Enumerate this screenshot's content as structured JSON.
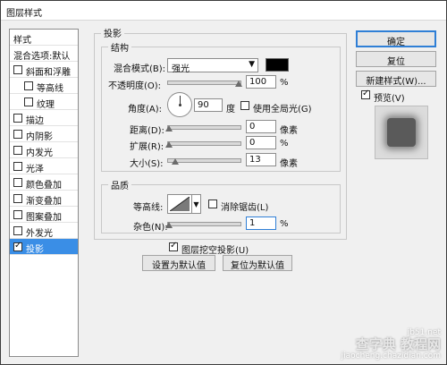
{
  "window": {
    "title": "图层样式"
  },
  "sidebar": {
    "header_styles": "样式",
    "header_blend": "混合选项:默认",
    "items": [
      {
        "label": "斜面和浮雕",
        "checked": false
      },
      {
        "label": "等高线",
        "checked": false
      },
      {
        "label": "纹理",
        "checked": false
      },
      {
        "label": "描边",
        "checked": false
      },
      {
        "label": "内阴影",
        "checked": false
      },
      {
        "label": "内发光",
        "checked": false
      },
      {
        "label": "光泽",
        "checked": false
      },
      {
        "label": "颜色叠加",
        "checked": false
      },
      {
        "label": "渐变叠加",
        "checked": false
      },
      {
        "label": "图案叠加",
        "checked": false
      },
      {
        "label": "外发光",
        "checked": false
      },
      {
        "label": "投影",
        "checked": true
      }
    ]
  },
  "panel": {
    "title": "投影",
    "structure": {
      "title": "结构",
      "blend_mode_label": "混合模式(B):",
      "blend_mode_value": "强光",
      "shadow_color": "#000000",
      "opacity_label": "不透明度(O):",
      "opacity_value": "100",
      "opacity_unit": "%",
      "angle_label": "角度(A):",
      "angle_value": "90",
      "angle_unit": "度",
      "global_light_label": "使用全局光(G)",
      "distance_label": "距离(D):",
      "distance_value": "0",
      "distance_unit": "像素",
      "spread_label": "扩展(R):",
      "spread_value": "0",
      "spread_unit": "%",
      "size_label": "大小(S):",
      "size_value": "13",
      "size_unit": "像素"
    },
    "quality": {
      "title": "品质",
      "contour_label": "等高线:",
      "antialias_label": "消除锯齿(L)",
      "noise_label": "杂色(N):",
      "noise_value": "1",
      "noise_unit": "%"
    },
    "knockout_label": "图层挖空投影(U)",
    "set_default_label": "设置为默认值",
    "reset_default_label": "复位为默认值"
  },
  "buttons": {
    "ok": "确定",
    "reset": "复位",
    "new_style": "新建样式(W)...",
    "preview_label": "预览(V)"
  },
  "watermark": {
    "line1": "jb51.net",
    "line2": "查字典 教程网",
    "line3": "jiaocheng.chazidian.com"
  }
}
